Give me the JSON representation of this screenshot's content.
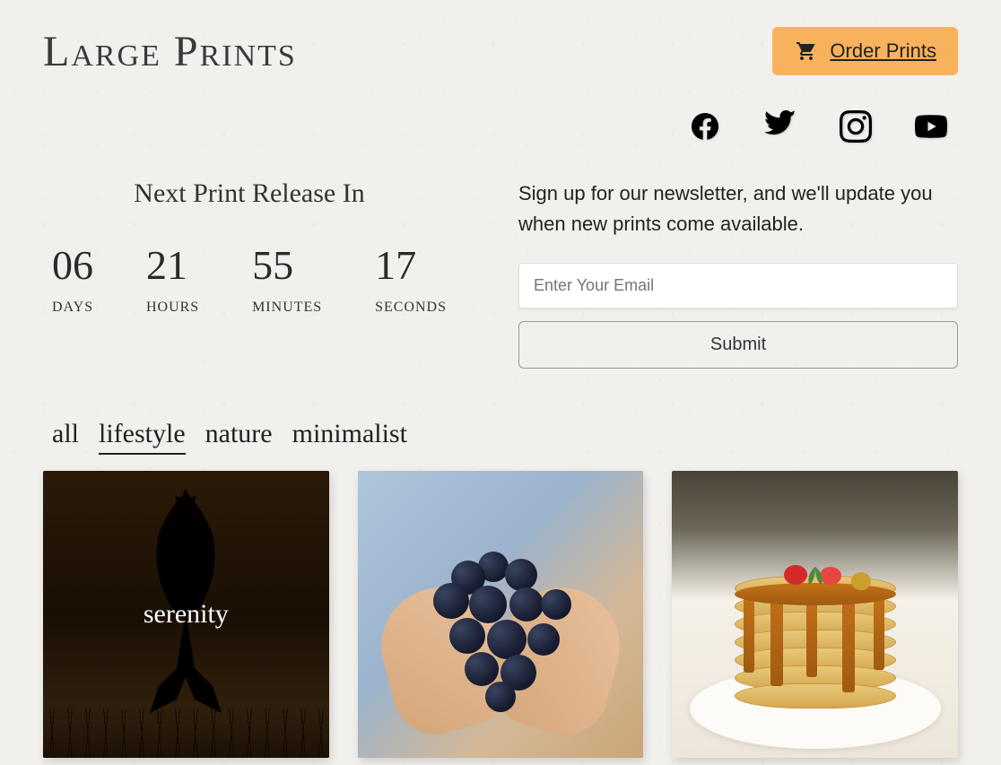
{
  "header": {
    "site_title": "Large Prints",
    "order_label": "Order Prints"
  },
  "countdown": {
    "title": "Next Print Release In",
    "days": "06",
    "days_label": "DAYS",
    "hours": "21",
    "hours_label": "HOURS",
    "minutes": "55",
    "minutes_label": "MINUTES",
    "seconds": "17",
    "seconds_label": "SECONDS"
  },
  "newsletter": {
    "text": "Sign up for our newsletter, and we'll update you when new prints come available.",
    "placeholder": "Enter Your Email",
    "submit_label": "Submit"
  },
  "filters": {
    "items": [
      "all",
      "lifestyle",
      "nature",
      "minimalist"
    ],
    "active": "lifestyle"
  },
  "gallery": {
    "card1_label": "serenity"
  }
}
